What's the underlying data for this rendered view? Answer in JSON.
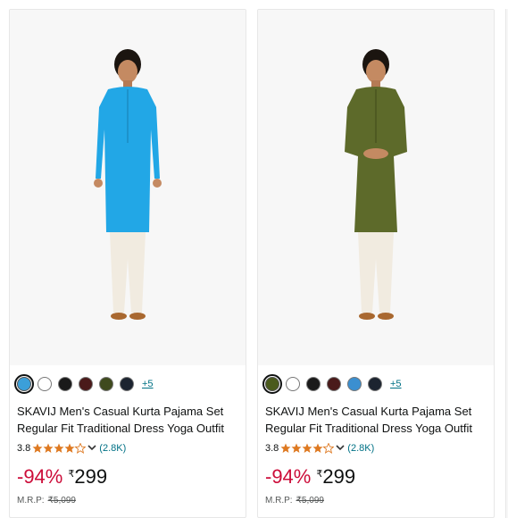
{
  "products": [
    {
      "swatches": [
        "#3b9fd9",
        "#ffffff",
        "#1a1a1a",
        "#4a1a1a",
        "#3f4a1e",
        "#1c2430"
      ],
      "selected_swatch": 0,
      "more_colors": "+5",
      "kurta_color": "#22a7e6",
      "title": "SKAVIJ Men's Casual Kurta Pajama Set Regular Fit Traditional Dress Yoga Outfit",
      "rating": "3.8",
      "stars": 4,
      "rating_count": "(2.8K)",
      "discount": "-94%",
      "currency": "₹",
      "price": "299",
      "mrp_label": "M.R.P:",
      "mrp_value": "₹5,099"
    },
    {
      "swatches": [
        "#4a5a1c",
        "#ffffff",
        "#1a1a1a",
        "#4a1a1a",
        "#3b8fd0",
        "#1c2430"
      ],
      "selected_swatch": 0,
      "more_colors": "+5",
      "kurta_color": "#5d6a2a",
      "title": "SKAVIJ Men's Casual Kurta Pajama Set Regular Fit Traditional Dress Yoga Outfit",
      "rating": "3.8",
      "stars": 4,
      "rating_count": "(2.8K)",
      "discount": "-94%",
      "currency": "₹",
      "price": "299",
      "mrp_label": "M.R.P:",
      "mrp_value": "₹5,099"
    }
  ],
  "star_color": "#de7921"
}
